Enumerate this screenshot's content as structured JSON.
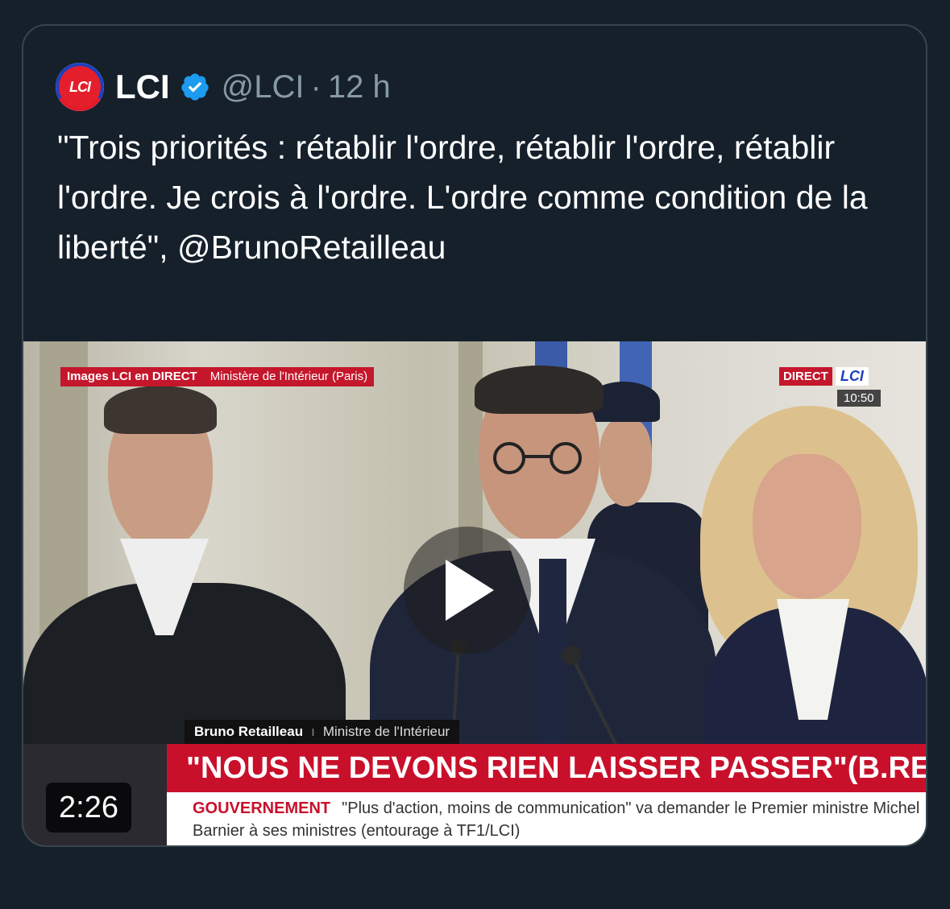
{
  "tweet": {
    "author_name": "LCI",
    "avatar_text": "LCI",
    "handle": "@LCI",
    "separator": "·",
    "timestamp": "12 h",
    "text": "\"Trois priorités : rétablir l'ordre, rétablir l'ordre, rétablir l'ordre. Je crois à l'ordre. L'ordre comme condition de la liberté\", @BrunoRetailleau"
  },
  "video": {
    "duration": "2:26",
    "overlay": {
      "top_label": "Images LCI en DIRECT",
      "top_location": "Ministère de l'Intérieur (Paris)",
      "direct_label": "DIRECT",
      "channel_logo": "LCI",
      "clock": "10:50",
      "speaker_name": "Bruno Retailleau",
      "speaker_role": "Ministre de l'Intérieur",
      "headline": "\"NOUS NE DEVONS RIEN LAISSER PASSER\"(B.RETAILLEAU)",
      "ticker_category": "GOUVERNEMENT",
      "ticker_text": "\"Plus d'action, moins de communication\" va demander le Premier ministre Michel Barnier à ses ministres (entourage à TF1/LCI)"
    }
  },
  "colors": {
    "background": "#15202b",
    "text_primary": "#ffffff",
    "text_secondary": "#8899a6",
    "verified": "#1d9bf0",
    "lci_red": "#c9102b"
  },
  "icons": {
    "verified": "verified-badge-icon",
    "play": "play-icon"
  }
}
